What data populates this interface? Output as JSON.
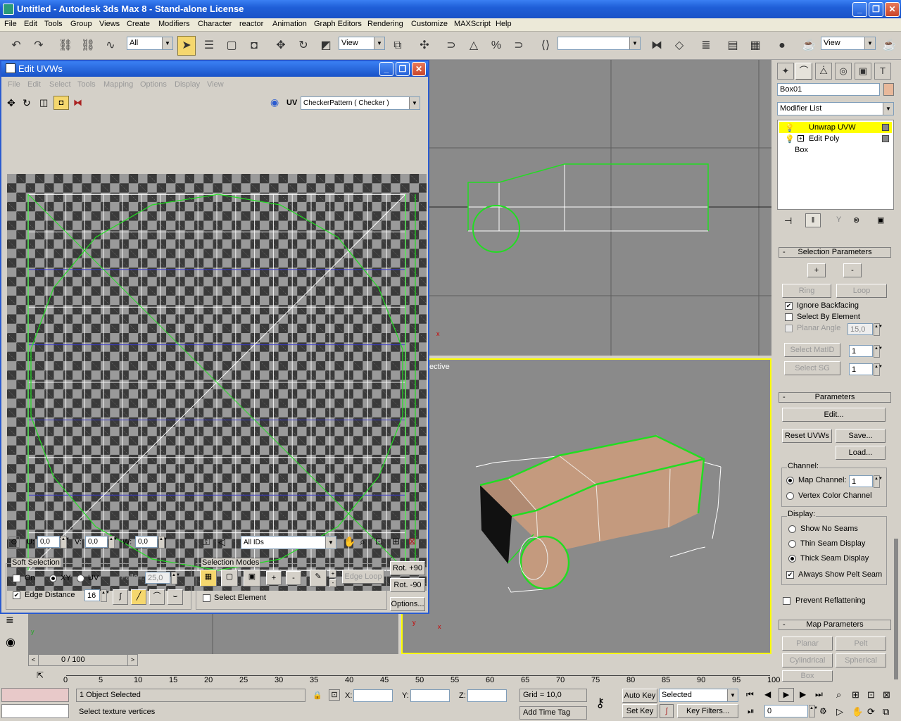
{
  "window": {
    "title": "Untitled   - Autodesk 3ds Max 8   - Stand-alone License"
  },
  "menu": [
    "File",
    "Edit",
    "Tools",
    "Group",
    "Views",
    "Create",
    "Modifiers",
    "Character",
    "reactor",
    "Animation",
    "Graph Editors",
    "Rendering",
    "Customize",
    "MAXScript",
    "Help"
  ],
  "toolbar": {
    "selection_filter": "All",
    "ref_coord": "View",
    "ref_coord2": "View"
  },
  "uvw": {
    "title": "Edit UVWs",
    "menu": [
      "File",
      "Edit",
      "Select",
      "Tools",
      "Mapping",
      "Options",
      "Display",
      "View"
    ],
    "uv_label": "UV",
    "texture": "CheckerPattern  ( Checker )",
    "u_label": "U:",
    "u_value": "0,0",
    "v_label": "V:",
    "v_value": "0,0",
    "w_label": "W:",
    "w_value": "0,0",
    "ids": "All IDs",
    "soft_selection": {
      "title": "Soft Selection",
      "on": "On",
      "xy": "XY",
      "uv": "UV",
      "falloff_label": "Falloff:",
      "falloff_value": "25,0",
      "edge_distance": "Edge Distance",
      "edge_distance_value": "16"
    },
    "selection_modes": {
      "title": "Selection Modes",
      "plus": "+",
      "minus": "-",
      "edge_loop": "Edge Loop",
      "select_element": "Select Element"
    },
    "rot_plus": "Rot. +90",
    "rot_minus": "Rot. -90",
    "options": "Options..."
  },
  "viewports": {
    "perspective_label": "ective"
  },
  "command_panel": {
    "object_name": "Box01",
    "modifier_list": "Modifier List",
    "stack": [
      "Unwrap UVW",
      "Edit Poly",
      "Box"
    ],
    "selection_parameters": {
      "title": "Selection Parameters",
      "plus": "+",
      "minus": "-",
      "ring": "Ring",
      "loop": "Loop",
      "ignore_backfacing": "Ignore Backfacing",
      "select_by_element": "Select By Element",
      "planar_angle": "Planar Angle",
      "planar_angle_value": "15,0",
      "select_matid": "Select MatID",
      "matid_value": "1",
      "select_sg": "Select SG",
      "sg_value": "1"
    },
    "parameters": {
      "title": "Parameters",
      "edit": "Edit...",
      "reset_uvws": "Reset UVWs",
      "save": "Save...",
      "load": "Load...",
      "channel": "Channel:",
      "map_channel": "Map Channel:",
      "map_channel_value": "1",
      "vertex_color_channel": "Vertex Color Channel",
      "display": "Display:",
      "show_no_seams": "Show No Seams",
      "thin_seam_display": "Thin Seam Display",
      "thick_seam_display": "Thick Seam Display",
      "always_show_pelt_seam": "Always Show Pelt Seam",
      "prevent_reflattening": "Prevent Reflattening"
    },
    "map_parameters": {
      "title": "Map Parameters",
      "planar": "Planar",
      "pelt": "Pelt",
      "cylindrical": "Cylindrical",
      "spherical": "Spherical",
      "box": "Box"
    }
  },
  "timeline": {
    "frame": "0 / 100",
    "ticks": [
      "0",
      "5",
      "10",
      "15",
      "20",
      "25",
      "30",
      "35",
      "40",
      "45",
      "50",
      "55",
      "60",
      "65",
      "70",
      "75",
      "80",
      "85",
      "90",
      "95",
      "100"
    ]
  },
  "status": {
    "objects_selected": "1 Object Selected",
    "prompt": "Select texture vertices",
    "x_label": "X:",
    "y_label": "Y:",
    "z_label": "Z:",
    "grid": "Grid = 10,0",
    "add_time_tag": "Add Time Tag",
    "auto_key": "Auto Key",
    "set_key": "Set Key",
    "selected": "Selected",
    "key_filters": "Key Filters...",
    "frame_value": "0"
  },
  "colors": {
    "titlebar": "#1f5fd8",
    "seam_green": "#00dd00",
    "active_yellow": "#ffff00",
    "mesh_tan": "#c49a7e"
  }
}
